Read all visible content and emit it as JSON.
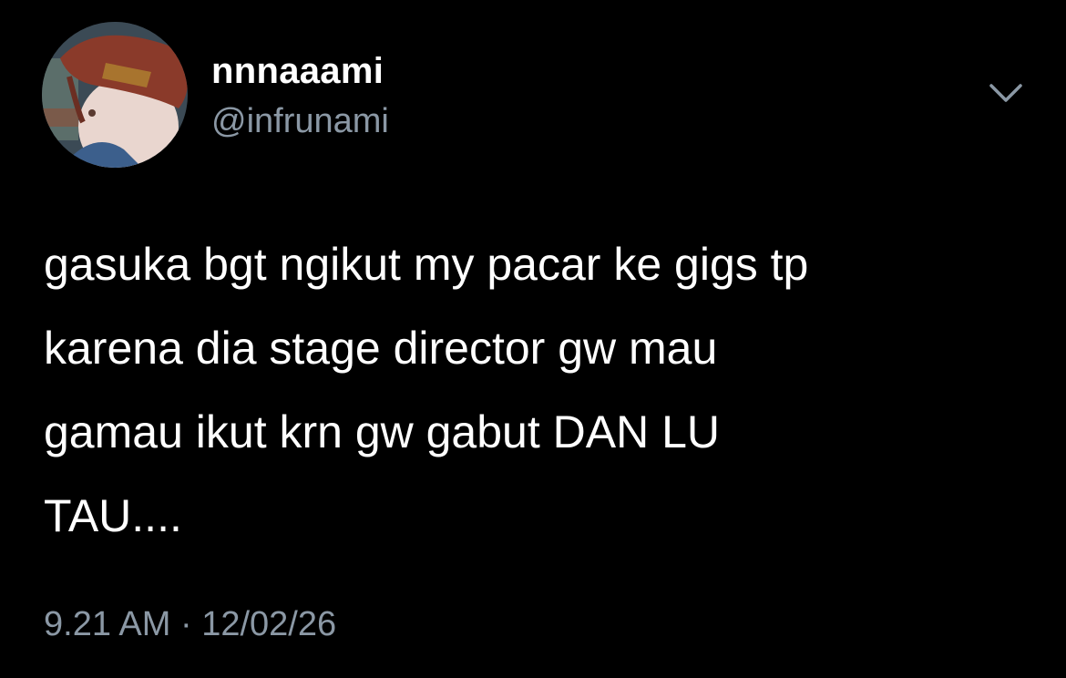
{
  "author": {
    "display_name": "nnnaaami",
    "handle": "@infrunami",
    "avatar_icon": "profile-photo"
  },
  "tweet": {
    "lines": [
      "gasuka bgt ngikut my pacar ke gigs tp",
      "karena dia stage director gw mau",
      "gamau ikut krn gw gabut DAN LU",
      "TAU...."
    ],
    "time": "9.21 AM",
    "separator": "·",
    "date": "12/02/26"
  },
  "menu": {
    "icon": "chevron-down-icon"
  },
  "colors": {
    "background": "#000000",
    "primary_text": "#ffffff",
    "secondary_text": "#8b98a5"
  }
}
